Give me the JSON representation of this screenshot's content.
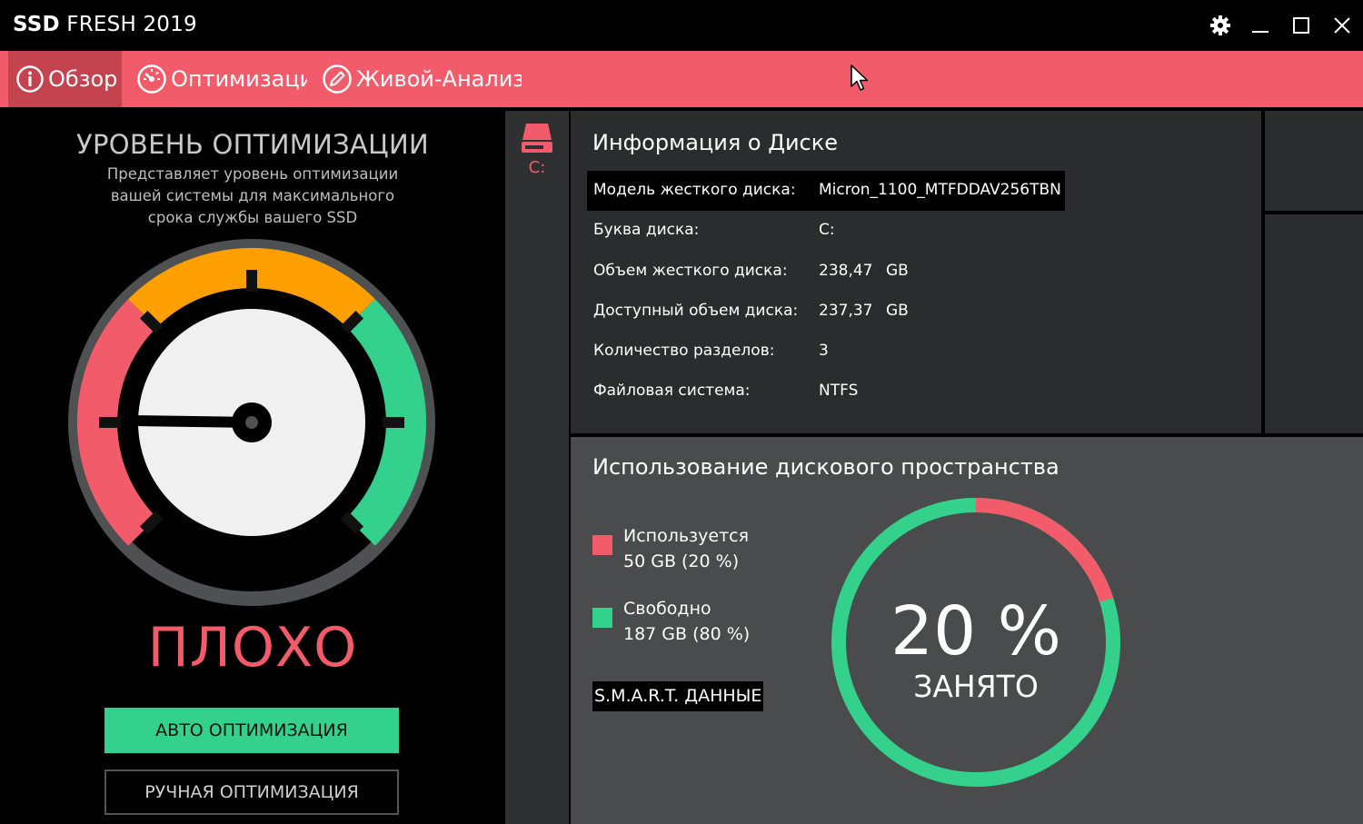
{
  "app": {
    "title_bold": "SSD",
    "title_rest": " FRESH 2019"
  },
  "window_controls": {
    "settings_icon": "gear-icon",
    "minimize_icon": "minimize-icon",
    "maximize_icon": "maximize-icon",
    "close_icon": "close-icon"
  },
  "nav": {
    "tabs": [
      {
        "label": "Обзор",
        "icon": "info-circle-icon",
        "active": true
      },
      {
        "label": "Оптимизация",
        "icon": "speedometer-icon",
        "active": false
      },
      {
        "label": "Живой-Анализ",
        "icon": "pencil-circle-icon",
        "active": false
      }
    ]
  },
  "optimization": {
    "title": "УРОВЕНЬ ОПТИМИЗАЦИИ",
    "description": "Представляет уровень оптимизации вашей системы для максимального срока службы вашего SSD",
    "gauge_level": 0.17,
    "status": "ПЛОХО",
    "auto_button": "АВТО ОПТИМИЗАЦИЯ",
    "manual_button": "РУЧНАЯ ОПТИМИЗАЦИЯ"
  },
  "drive": {
    "letter": "C:",
    "icon": "hard-drive-icon"
  },
  "disk_info": {
    "title": "Информация о Диске",
    "rows": [
      {
        "label": "Модель жесткого диска:",
        "value": "Micron_1100_MTFDDAV256TBN",
        "unit": ""
      },
      {
        "label": "Буква диска:",
        "value": "C:",
        "unit": ""
      },
      {
        "label": "Объем жесткого диска:",
        "value": "238,47",
        "unit": "GB"
      },
      {
        "label": "Доступный объем диска:",
        "value": "237,37",
        "unit": "GB"
      },
      {
        "label": "Количество разделов:",
        "value": "3",
        "unit": ""
      },
      {
        "label": "Файловая система:",
        "value": "NTFS",
        "unit": ""
      }
    ]
  },
  "usage": {
    "title": "Использование дискового пространства",
    "used_label": "Используется",
    "used_value": "50 GB (20 %)",
    "free_label": "Свободно",
    "free_value": "187 GB (80 %)",
    "smart_button": "S.M.A.R.T. ДАННЫЕ",
    "percent_text": "20 %",
    "percent_caption": "ЗАНЯТО",
    "used_fraction": 0.2
  },
  "colors": {
    "accent_red": "#f25c6a",
    "accent_green": "#33d18c",
    "accent_orange": "#ffa000",
    "nav_active": "#c5434f"
  }
}
